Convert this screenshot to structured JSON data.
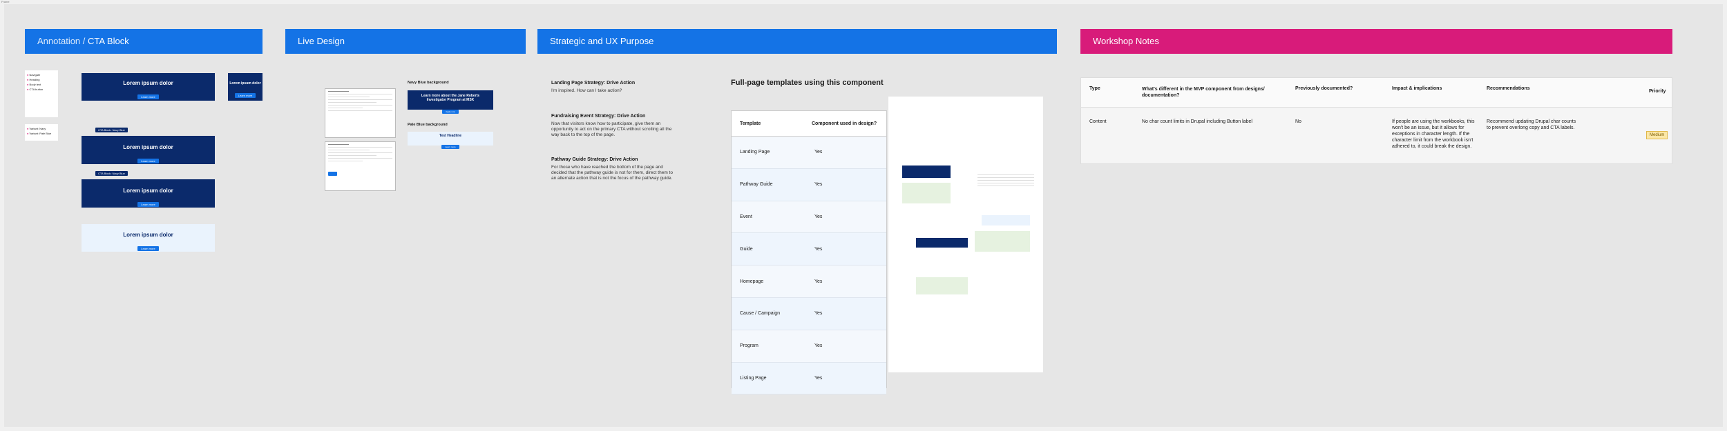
{
  "canvas_label": "Frame",
  "annotation": {
    "header_prefix": "Annotation / ",
    "header_suffix": "CTA Block",
    "legend_items": [
      "Navigate",
      "Heading",
      "Body text",
      "CTA button"
    ],
    "legend_items_2": [
      "Variant: Navy",
      "Variant: Pale Blue"
    ],
    "cta_title": "Lorem ipsum dolor",
    "cta_button": "Learn more",
    "label_navy": "CTA Block: Navy Blue",
    "label_navy_alt": "CTA Block: Navy Blue"
  },
  "live_design": {
    "header": "Live Design",
    "navy_label": "Navy Blue background",
    "navy_text": "Learn more about the Jane Roberts Investigator Program at MSK",
    "navy_button": "Apply now",
    "pale_label": "Pale Blue background",
    "pale_text": "Test Headline",
    "pale_button": "Learn more"
  },
  "strategic": {
    "header": "Strategic and UX Purpose",
    "sections": [
      {
        "title": "Landing Page Strategy: Drive Action",
        "body": "I'm inspired. How can I take action?"
      },
      {
        "title": "Fundraising Event Strategy: Drive Action",
        "body": "Now that visitors know how to participate, give them an opportunity to act on the primary CTA without scrolling all the way back to the top of the page."
      },
      {
        "title": "Pathway Guide Strategy: Drive Action",
        "body": "For those who have reached the bottom of the page and decided that the pathway guide is not for them, direct them to an alternate action that is not the focus of the pathway guide."
      }
    ],
    "templates_title": "Full-page templates using this component",
    "table_headers": [
      "Template",
      "Component used in design?"
    ],
    "table_rows": [
      [
        "Landing Page",
        "Yes"
      ],
      [
        "Pathway Guide",
        "Yes"
      ],
      [
        "Event",
        "Yes"
      ],
      [
        "Guide",
        "Yes"
      ],
      [
        "Homepage",
        "Yes"
      ],
      [
        "Cause / Campaign",
        "Yes"
      ],
      [
        "Program",
        "Yes"
      ],
      [
        "Listing Page",
        "Yes"
      ]
    ]
  },
  "workshop": {
    "header": "Workshop Notes",
    "columns": [
      "Type",
      "What's different in the MVP component from designs/ documentation?",
      "Previously documented?",
      "Impact & implications",
      "Recommendations",
      "Priority"
    ],
    "row": {
      "type": "Content",
      "difference": "No char count limits in Drupal including Button label",
      "documented": "No",
      "impact": "If people are using the workbooks, this won't be an issue, but it allows for exceptions in character length. If the character limit from the workbook isn't adhered to, it could break the design.",
      "recommendation": "Recommend updating Drupal char counts to prevent overlong copy and CTA labels.",
      "priority": "Medium"
    }
  },
  "colors": {
    "accent_blue": "#1473e6",
    "navy": "#0b2a6b",
    "pink": "#d81b7a",
    "pale_blue": "#eaf3fd",
    "priority_bg": "#fbe7a6"
  }
}
